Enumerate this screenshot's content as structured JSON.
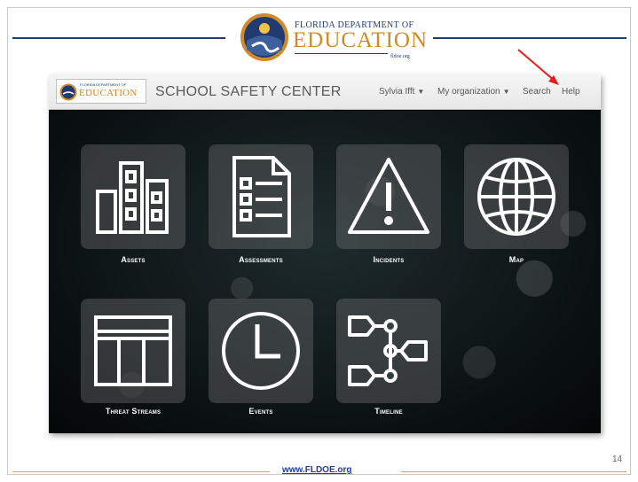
{
  "header": {
    "dept_line": "FLORIDA DEPARTMENT OF",
    "education_word": "EDUCATION",
    "site": "fldoe.org",
    "brand_navy": "#1f3b6f",
    "brand_gold": "#cf8a2a"
  },
  "app": {
    "logo": {
      "dept_line": "FLORIDA DEPARTMENT OF",
      "education_word": "EDUCATION",
      "site": "fldoe.org"
    },
    "title": "SCHOOL SAFETY CENTER",
    "nav": {
      "user": "Sylvia Ifft",
      "organization": "My organization",
      "search": "Search",
      "help": "Help",
      "caret": "▼"
    },
    "tiles": [
      {
        "label": "Assets",
        "icon": "buildings-icon"
      },
      {
        "label": "Assessments",
        "icon": "checklist-document-icon"
      },
      {
        "label": "Incidents",
        "icon": "warning-triangle-icon"
      },
      {
        "label": "Map",
        "icon": "globe-icon"
      },
      {
        "label": "Threat Streams",
        "icon": "table-columns-icon"
      },
      {
        "label": "Events",
        "icon": "clock-icon"
      },
      {
        "label": "Timeline",
        "icon": "timeline-tags-icon"
      }
    ]
  },
  "annotation": {
    "arrow_color": "#e0201c",
    "icon": "red-arrow-pointing-to-help"
  },
  "footer": {
    "url": "www.FLDOE.org",
    "slide_number": "14",
    "line_color": "#d7a55a"
  }
}
